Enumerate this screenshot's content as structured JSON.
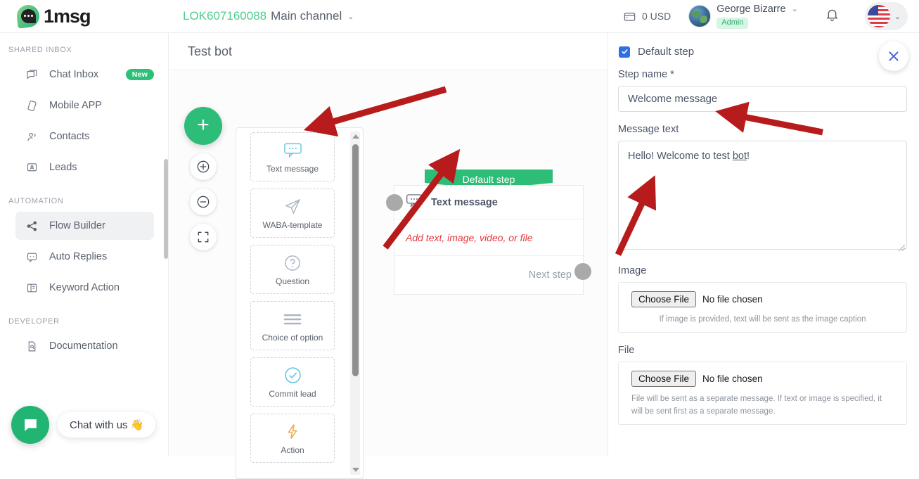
{
  "header": {
    "brand": "1msg",
    "channel_code": "LOK607160088",
    "channel_name": "Main channel",
    "wallet_amount": "0 USD",
    "user_name": "George Bizarre",
    "user_role": "Admin",
    "caret": "⌄",
    "icons": {
      "wallet": "wallet-icon",
      "bell": "bell-icon",
      "flag": "us-flag-icon"
    }
  },
  "sidebar": {
    "groups": [
      {
        "title": "SHARED INBOX",
        "items": [
          {
            "label": "Chat Inbox",
            "icon": "chat-icon",
            "badge": "New",
            "active": false
          },
          {
            "label": "Mobile APP",
            "icon": "mobile-icon",
            "badge": "",
            "active": false
          },
          {
            "label": "Contacts",
            "icon": "contacts-icon",
            "badge": "",
            "active": false
          },
          {
            "label": "Leads",
            "icon": "leads-icon",
            "badge": "",
            "active": false
          }
        ]
      },
      {
        "title": "AUTOMATION",
        "items": [
          {
            "label": "Flow Builder",
            "icon": "share-nodes-icon",
            "badge": "",
            "active": true
          },
          {
            "label": "Auto Replies",
            "icon": "auto-reply-icon",
            "badge": "",
            "active": false
          },
          {
            "label": "Keyword Action",
            "icon": "keyword-icon",
            "badge": "",
            "active": false
          }
        ]
      },
      {
        "title": "DEVELOPER",
        "items": [
          {
            "label": "Documentation",
            "icon": "document-icon",
            "badge": "",
            "active": false
          }
        ]
      }
    ]
  },
  "chat_widget": {
    "label": "Chat with us 👋",
    "icon": "chat-bubble-icon"
  },
  "main": {
    "title": "Test bot",
    "zoom_controls": {
      "add": "+",
      "zoom_in": "zoom-in-icon",
      "zoom_out": "zoom-out-icon",
      "fit": "fit-screen-icon"
    },
    "palette": [
      {
        "label": "Text message",
        "icon": "text-message-icon"
      },
      {
        "label": "WABA-template",
        "icon": "paper-plane-icon"
      },
      {
        "label": "Question",
        "icon": "question-mark-icon"
      },
      {
        "label": "Choice of option",
        "icon": "list-lines-icon"
      },
      {
        "label": "Commit lead",
        "icon": "check-circle-icon"
      },
      {
        "label": "Action",
        "icon": "lightning-bolt-icon"
      }
    ],
    "node": {
      "header": "Default step",
      "type_label": "Text message",
      "placeholder": "Add text, image, video, or file",
      "next_label": "Next step",
      "icon": "text-message-icon"
    }
  },
  "panel": {
    "default_step_label": "Default step",
    "default_step_checked": true,
    "close_icon": "close-icon",
    "step_name_label": "Step name *",
    "step_name_value": "Welcome message",
    "message_text_label": "Message text",
    "message_text_value": "Hello! Welcome to test bot!",
    "message_text_prefix": "Hello! Welcome to test ",
    "message_text_spelled": "bot",
    "message_text_suffix": "!",
    "image_label": "Image",
    "image_button": "Choose File",
    "image_no_file": "No file chosen",
    "image_hint": "If image is provided, text will be sent as the image caption",
    "file_label": "File",
    "file_button": "Choose File",
    "file_no_file": "No file chosen",
    "file_hint": "File will be sent as a separate message. If text or image is specified, it will be sent first as a separate message."
  },
  "colors": {
    "brand_green": "#2dbd78",
    "node_green": "#2ebd77",
    "accent_blue": "#2f6fe4",
    "placeholder_red": "#e2383c",
    "annotation_red": "#b81b1b"
  }
}
